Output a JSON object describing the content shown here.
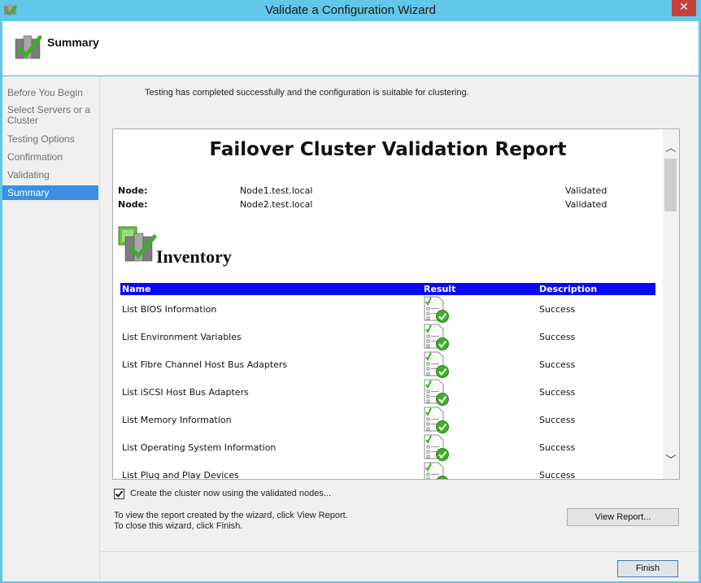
{
  "window": {
    "title": "Validate a Configuration Wizard",
    "close_glyph": "✕",
    "icon": "cluster-validate-icon"
  },
  "header": {
    "title": "Summary",
    "icon": "cluster-check-icon"
  },
  "nav": {
    "items": [
      {
        "label": "Before You Begin",
        "active": false
      },
      {
        "label": "Select Servers or a Cluster",
        "active": false
      },
      {
        "label": "Testing Options",
        "active": false
      },
      {
        "label": "Confirmation",
        "active": false
      },
      {
        "label": "Validating",
        "active": false
      },
      {
        "label": "Summary",
        "active": true
      }
    ]
  },
  "main": {
    "status_text": "Testing has completed successfully and the configuration is suitable for clustering."
  },
  "report": {
    "title": "Failover Cluster Validation Report",
    "nodes": [
      {
        "label": "Node:",
        "name": "Node1.test.local",
        "status": "Validated"
      },
      {
        "label": "Node:",
        "name": "Node2.test.local",
        "status": "Validated"
      }
    ],
    "section_title": "Inventory",
    "table": {
      "headers": {
        "name": "Name",
        "result": "Result",
        "description": "Description"
      },
      "rows": [
        {
          "name": "List BIOS Information",
          "description": "Success"
        },
        {
          "name": "List Environment Variables",
          "description": "Success"
        },
        {
          "name": "List Fibre Channel Host Bus Adapters",
          "description": "Success"
        },
        {
          "name": "List iSCSI Host Bus Adapters",
          "description": "Success"
        },
        {
          "name": "List Memory Information",
          "description": "Success"
        },
        {
          "name": "List Operating System Information",
          "description": "Success"
        },
        {
          "name": "List Plug and Play Devices",
          "description": "Success"
        }
      ]
    },
    "scroll_up_glyph": "︿",
    "scroll_down_glyph": "﹀"
  },
  "options": {
    "create_cluster_checked": true,
    "create_cluster_label": "Create the cluster now using the validated nodes..."
  },
  "info": {
    "line1": "To view the report created by the wizard, click View Report.",
    "line2": "To close this wizard, click Finish."
  },
  "buttons": {
    "view_report": "View Report...",
    "finish": "Finish"
  },
  "colors": {
    "title_bar": "#61c8e8",
    "close": "#c7403a",
    "nav_active": "#3a8fe0",
    "table_header": "#0a0af2",
    "check_green": "#3fae2a"
  }
}
